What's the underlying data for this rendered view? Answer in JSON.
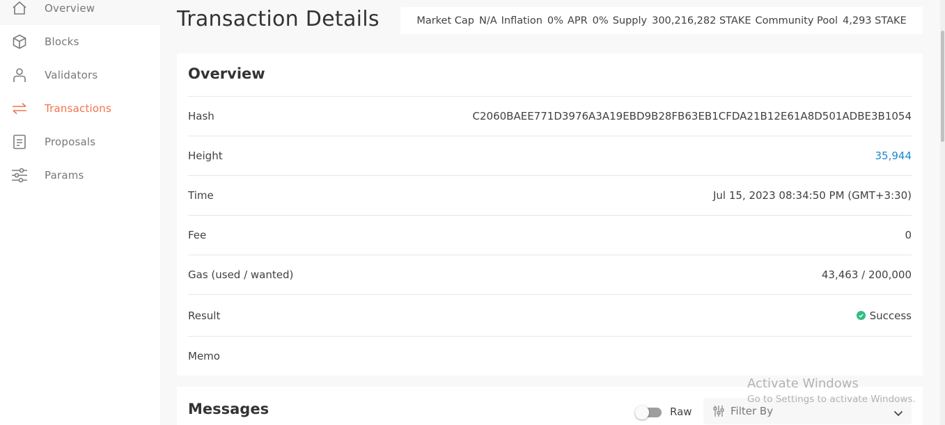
{
  "sidebar": {
    "items": [
      {
        "label": "Overview",
        "icon": "home-icon"
      },
      {
        "label": "Blocks",
        "icon": "cube-icon"
      },
      {
        "label": "Validators",
        "icon": "person-icon"
      },
      {
        "label": "Transactions",
        "icon": "arrows-swap-icon"
      },
      {
        "label": "Proposals",
        "icon": "document-icon"
      },
      {
        "label": "Params",
        "icon": "sliders-icon"
      }
    ],
    "active_color": "#f2734b"
  },
  "header": {
    "title": "Transaction Details",
    "stats": [
      {
        "label": "Market Cap",
        "value": "N/A"
      },
      {
        "label": "Inflation",
        "value": "0%"
      },
      {
        "label": "APR",
        "value": "0%"
      },
      {
        "label": "Supply",
        "value": "300,216,282 STAKE"
      },
      {
        "label": "Community Pool",
        "value": "4,293 STAKE"
      }
    ]
  },
  "overview": {
    "title": "Overview",
    "rows": [
      {
        "label": "Hash",
        "value": "C2060BAEE771D3976A3A19EBD9B28FB63EB1CFDA21B12E61A8D501ADBE3B1054"
      },
      {
        "label": "Height",
        "value": "35,944"
      },
      {
        "label": "Time",
        "value": "Jul 15, 2023 08:34:50 PM (GMT+3:30)"
      },
      {
        "label": "Fee",
        "value": "0"
      },
      {
        "label": "Gas (used / wanted)",
        "value": "43,463 / 200,000"
      },
      {
        "label": "Result",
        "value": "Success"
      },
      {
        "label": "Memo",
        "value": ""
      }
    ],
    "link_color": "#1e88d0",
    "success_color": "#2ebd85"
  },
  "messages": {
    "title": "Messages",
    "raw_label": "Raw",
    "raw_enabled": false,
    "filter_placeholder": "Filter By"
  },
  "watermark": {
    "title": "Activate Windows",
    "subtitle": "Go to Settings to activate Windows."
  }
}
